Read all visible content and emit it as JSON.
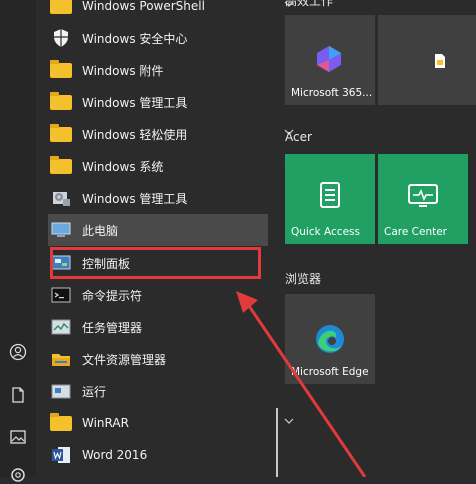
{
  "rail": {
    "icons": [
      "user-icon",
      "document-icon",
      "pictures-icon",
      "settings-icon"
    ]
  },
  "apps": [
    {
      "label": "Windows PowerShell",
      "icon": "folder",
      "chevron": "down"
    },
    {
      "label": "Windows 安全中心",
      "icon": "shield"
    },
    {
      "label": "Windows 附件",
      "icon": "folder",
      "chevron": "down"
    },
    {
      "label": "Windows 管理工具",
      "icon": "folder",
      "chevron": "down"
    },
    {
      "label": "Windows 轻松使用",
      "icon": "folder",
      "chevron": "down"
    },
    {
      "label": "Windows 系统",
      "icon": "folder",
      "chevron": "up"
    },
    {
      "label": "Windows 管理工具",
      "icon": "admin-tools"
    },
    {
      "label": "此电脑",
      "icon": "computer"
    },
    {
      "label": "控制面板",
      "icon": "control-panel"
    },
    {
      "label": "命令提示符",
      "icon": "cmd"
    },
    {
      "label": "任务管理器",
      "icon": "task-manager"
    },
    {
      "label": "文件资源管理器",
      "icon": "file-explorer"
    },
    {
      "label": "运行",
      "icon": "run"
    },
    {
      "label": "WinRAR",
      "icon": "folder",
      "chevron": "down"
    },
    {
      "label": "Word 2016",
      "icon": "word"
    }
  ],
  "tiles": {
    "groups": [
      {
        "label": "高效工作"
      },
      {
        "label": "Acer"
      },
      {
        "label": "浏览器"
      }
    ],
    "items": [
      {
        "label": "Microsoft 365...",
        "color": "#404040"
      },
      {
        "label": "",
        "color": "#404040"
      },
      {
        "label": "Quick Access",
        "color": "#21a064"
      },
      {
        "label": "Care Center",
        "color": "#21a064"
      },
      {
        "label": "Microsoft Edge",
        "color": "#404040"
      }
    ]
  },
  "colors": {
    "highlight": "#e03a3a",
    "accent_green": "#21a064",
    "folder": "#f4c12b"
  }
}
